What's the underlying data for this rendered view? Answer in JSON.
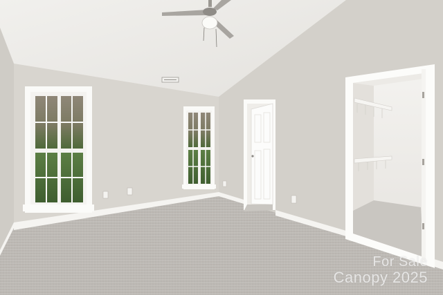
{
  "photo": {
    "subject": "empty bedroom",
    "watermark": {
      "line1": "For Sale",
      "line2": "Canopy 2025"
    },
    "colors": {
      "wall": "#d9d6d0",
      "ceiling": "#ebe9e5",
      "carpet": "#bcb8b3",
      "trim": "#f7f6f3"
    }
  }
}
